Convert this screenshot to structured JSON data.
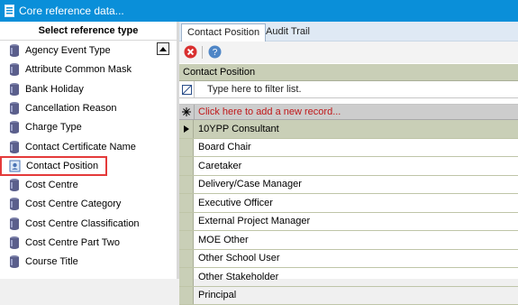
{
  "window": {
    "title": "Core reference data..."
  },
  "left_pane": {
    "header": "Select reference type",
    "items": [
      {
        "label": "Agency Event Type",
        "selected": false
      },
      {
        "label": "Attribute Common Mask",
        "selected": false
      },
      {
        "label": "Bank Holiday",
        "selected": false
      },
      {
        "label": "Cancellation Reason",
        "selected": false
      },
      {
        "label": "Charge Type",
        "selected": false
      },
      {
        "label": "Contact Certificate Name",
        "selected": false
      },
      {
        "label": "Contact Position",
        "selected": true
      },
      {
        "label": "Cost Centre",
        "selected": false
      },
      {
        "label": "Cost Centre Category",
        "selected": false
      },
      {
        "label": "Cost Centre Classification",
        "selected": false
      },
      {
        "label": "Cost Centre Part Two",
        "selected": false
      },
      {
        "label": "Course Title",
        "selected": false
      }
    ]
  },
  "tabs": [
    {
      "label": "Contact Position",
      "active": true
    },
    {
      "label": "Audit Trail",
      "active": false
    }
  ],
  "toolbar": {
    "buttons": [
      "delete-icon",
      "help-icon"
    ]
  },
  "grid": {
    "caption": "Contact Position",
    "filter_placeholder": "Type here to filter list.",
    "new_record_text": "Click here to add a new record...",
    "rows": [
      "10YPP Consultant",
      "Board Chair",
      "Caretaker",
      "Delivery/Case Manager",
      "Executive Officer",
      "External Project Manager",
      "MOE Other",
      "Other School User",
      "Other Stakeholder",
      "Principal"
    ]
  },
  "colors": {
    "titlebar": "#0a8fd9",
    "grid_header": "#c9cfb7",
    "selection_outline": "#e43a3a",
    "new_record_text": "#c0181a"
  }
}
